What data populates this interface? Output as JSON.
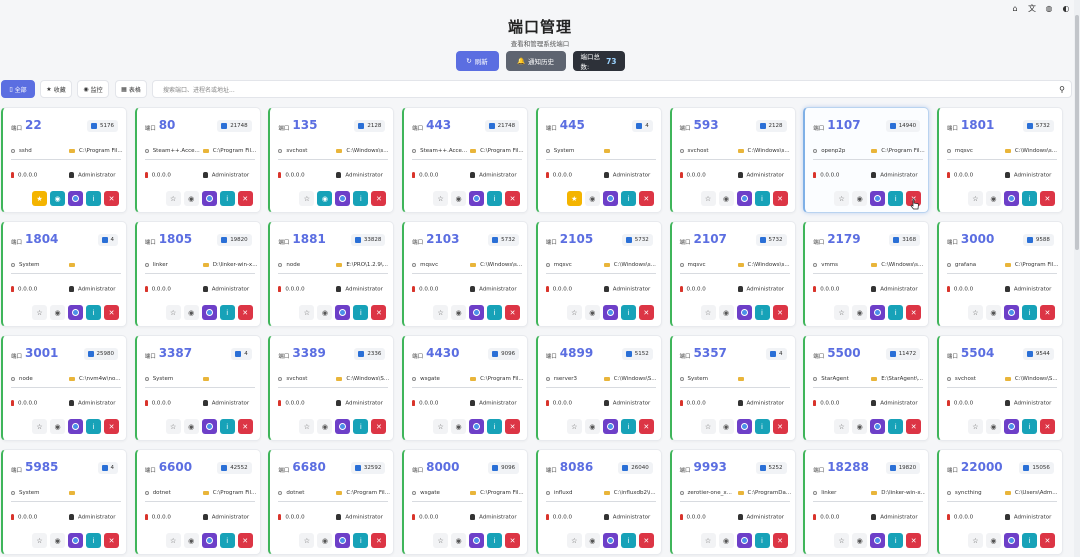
{
  "top_icons": [
    {
      "name": "home-icon",
      "glyph": "⌂"
    },
    {
      "name": "translate-icon",
      "glyph": "文"
    },
    {
      "name": "globe-icon",
      "glyph": "◍"
    },
    {
      "name": "theme-icon",
      "glyph": "◐"
    }
  ],
  "header": {
    "title": "端口管理",
    "subtitle": "查看和管理系统端口"
  },
  "actions": {
    "refresh_label": "刷新",
    "history_label": "通知历史",
    "stat_label": "端口总数:",
    "stat_value": "73"
  },
  "filters": [
    {
      "label": "全部",
      "icon": "▯",
      "active": true
    },
    {
      "label": "收藏",
      "icon": "★",
      "active": false
    },
    {
      "label": "监控",
      "icon": "◉",
      "active": false
    },
    {
      "label": "表格",
      "icon": "▦",
      "active": false
    }
  ],
  "search": {
    "placeholder": "搜索端口、进程名或地址..."
  },
  "port_label": "端口",
  "cards": [
    {
      "port": "22",
      "pid": "5176",
      "process": "sshd",
      "path": "C:\\Program Fil...",
      "address": "0.0.0.0",
      "user": "Administrator",
      "fav": true,
      "mon": true
    },
    {
      "port": "80",
      "pid": "21748",
      "process": "Steam++.Acce...",
      "path": "C:\\Program Fil...",
      "address": "0.0.0.0",
      "user": "Administrator",
      "fav": false,
      "mon": false
    },
    {
      "port": "135",
      "pid": "2128",
      "process": "svchost",
      "path": "C:\\Windows\\s...",
      "address": "0.0.0.0",
      "user": "Administrator",
      "fav": false,
      "mon": true
    },
    {
      "port": "443",
      "pid": "21748",
      "process": "Steam++.Acce...",
      "path": "C:\\Program Fil...",
      "address": "0.0.0.0",
      "user": "Administrator",
      "fav": false,
      "mon": false
    },
    {
      "port": "445",
      "pid": "4",
      "process": "System",
      "path": "",
      "address": "0.0.0.0",
      "user": "Administrator",
      "fav": true,
      "mon": false
    },
    {
      "port": "593",
      "pid": "2128",
      "process": "svchost",
      "path": "C:\\Windows\\s...",
      "address": "0.0.0.0",
      "user": "Administrator",
      "fav": false,
      "mon": false
    },
    {
      "port": "1107",
      "pid": "14940",
      "process": "openp2p",
      "path": "C:\\Program Fil...",
      "address": "0.0.0.0",
      "user": "Administrator",
      "fav": false,
      "mon": false
    },
    {
      "port": "1801",
      "pid": "5732",
      "process": "mqsvc",
      "path": "C:\\Windows\\s...",
      "address": "0.0.0.0",
      "user": "Administrator",
      "fav": false,
      "mon": false
    },
    {
      "port": "1804",
      "pid": "4",
      "process": "System",
      "path": "",
      "address": "0.0.0.0",
      "user": "Administrator",
      "fav": false,
      "mon": false
    },
    {
      "port": "1805",
      "pid": "19820",
      "process": "linker",
      "path": "D:\\linker-win-x...",
      "address": "0.0.0.0",
      "user": "Administrator",
      "fav": false,
      "mon": false
    },
    {
      "port": "1881",
      "pid": "33828",
      "process": "node",
      "path": "E:\\PRO\\1.2.9\\...",
      "address": "0.0.0.0",
      "user": "Administrator",
      "fav": false,
      "mon": false
    },
    {
      "port": "2103",
      "pid": "5732",
      "process": "mqsvc",
      "path": "C:\\Windows\\s...",
      "address": "0.0.0.0",
      "user": "Administrator",
      "fav": false,
      "mon": false
    },
    {
      "port": "2105",
      "pid": "5732",
      "process": "mqsvc",
      "path": "C:\\Windows\\s...",
      "address": "0.0.0.0",
      "user": "Administrator",
      "fav": false,
      "mon": false
    },
    {
      "port": "2107",
      "pid": "5732",
      "process": "mqsvc",
      "path": "C:\\Windows\\s...",
      "address": "0.0.0.0",
      "user": "Administrator",
      "fav": false,
      "mon": false
    },
    {
      "port": "2179",
      "pid": "3168",
      "process": "vmms",
      "path": "C:\\Windows\\s...",
      "address": "0.0.0.0",
      "user": "Administrator",
      "fav": false,
      "mon": false
    },
    {
      "port": "3000",
      "pid": "9588",
      "process": "grafana",
      "path": "C:\\Program Fil...",
      "address": "0.0.0.0",
      "user": "Administrator",
      "fav": false,
      "mon": false
    },
    {
      "port": "3001",
      "pid": "25980",
      "process": "node",
      "path": "C:\\nvm4w\\no...",
      "address": "0.0.0.0",
      "user": "Administrator",
      "fav": false,
      "mon": false
    },
    {
      "port": "3387",
      "pid": "4",
      "process": "System",
      "path": "",
      "address": "0.0.0.0",
      "user": "Administrator",
      "fav": false,
      "mon": false
    },
    {
      "port": "3389",
      "pid": "2336",
      "process": "svchost",
      "path": "C:\\Windows\\S...",
      "address": "0.0.0.0",
      "user": "Administrator",
      "fav": false,
      "mon": false
    },
    {
      "port": "4430",
      "pid": "9096",
      "process": "wsgate",
      "path": "C:\\Program Fil...",
      "address": "0.0.0.0",
      "user": "Administrator",
      "fav": false,
      "mon": false
    },
    {
      "port": "4899",
      "pid": "5152",
      "process": "rserver3",
      "path": "C:\\Windows\\S...",
      "address": "0.0.0.0",
      "user": "Administrator",
      "fav": false,
      "mon": false
    },
    {
      "port": "5357",
      "pid": "4",
      "process": "System",
      "path": "",
      "address": "0.0.0.0",
      "user": "Administrator",
      "fav": false,
      "mon": false
    },
    {
      "port": "5500",
      "pid": "11472",
      "process": "StarAgent",
      "path": "E:\\StarAgent\\...",
      "address": "0.0.0.0",
      "user": "Administrator",
      "fav": false,
      "mon": false
    },
    {
      "port": "5504",
      "pid": "9544",
      "process": "svchost",
      "path": "C:\\Windows\\S...",
      "address": "0.0.0.0",
      "user": "Administrator",
      "fav": false,
      "mon": false
    },
    {
      "port": "5985",
      "pid": "4",
      "process": "System",
      "path": "",
      "address": "0.0.0.0",
      "user": "Administrator",
      "fav": false,
      "mon": false
    },
    {
      "port": "6600",
      "pid": "42552",
      "process": "dotnet",
      "path": "C:\\Program Fil...",
      "address": "0.0.0.0",
      "user": "Administrator",
      "fav": false,
      "mon": false
    },
    {
      "port": "6680",
      "pid": "32592",
      "process": "dotnet",
      "path": "C:\\Program Fil...",
      "address": "0.0.0.0",
      "user": "Administrator",
      "fav": false,
      "mon": false
    },
    {
      "port": "8000",
      "pid": "9096",
      "process": "wsgate",
      "path": "C:\\Program Fil...",
      "address": "0.0.0.0",
      "user": "Administrator",
      "fav": false,
      "mon": false
    },
    {
      "port": "8086",
      "pid": "26040",
      "process": "influxd",
      "path": "C:\\influxdb2\\i...",
      "address": "0.0.0.0",
      "user": "Administrator",
      "fav": false,
      "mon": false
    },
    {
      "port": "9993",
      "pid": "5252",
      "process": "zerotier-one_x...",
      "path": "C:\\ProgramDa...",
      "address": "0.0.0.0",
      "user": "Administrator",
      "fav": false,
      "mon": false
    },
    {
      "port": "18288",
      "pid": "19820",
      "process": "linker",
      "path": "D:\\linker-win-x...",
      "address": "0.0.0.0",
      "user": "Administrator",
      "fav": false,
      "mon": false
    },
    {
      "port": "22000",
      "pid": "15056",
      "process": "syncthing",
      "path": "C:\\Users\\Adm...",
      "address": "0.0.0.0",
      "user": "Administrator",
      "fav": false,
      "mon": false
    }
  ],
  "highlight_index": 6,
  "colors": {
    "accent": "#5b6ee1",
    "success_border": "#3fb55a",
    "danger": "#dc3545",
    "info": "#17a2b8",
    "purple": "#6d3fc8",
    "star": "#f4b400"
  }
}
